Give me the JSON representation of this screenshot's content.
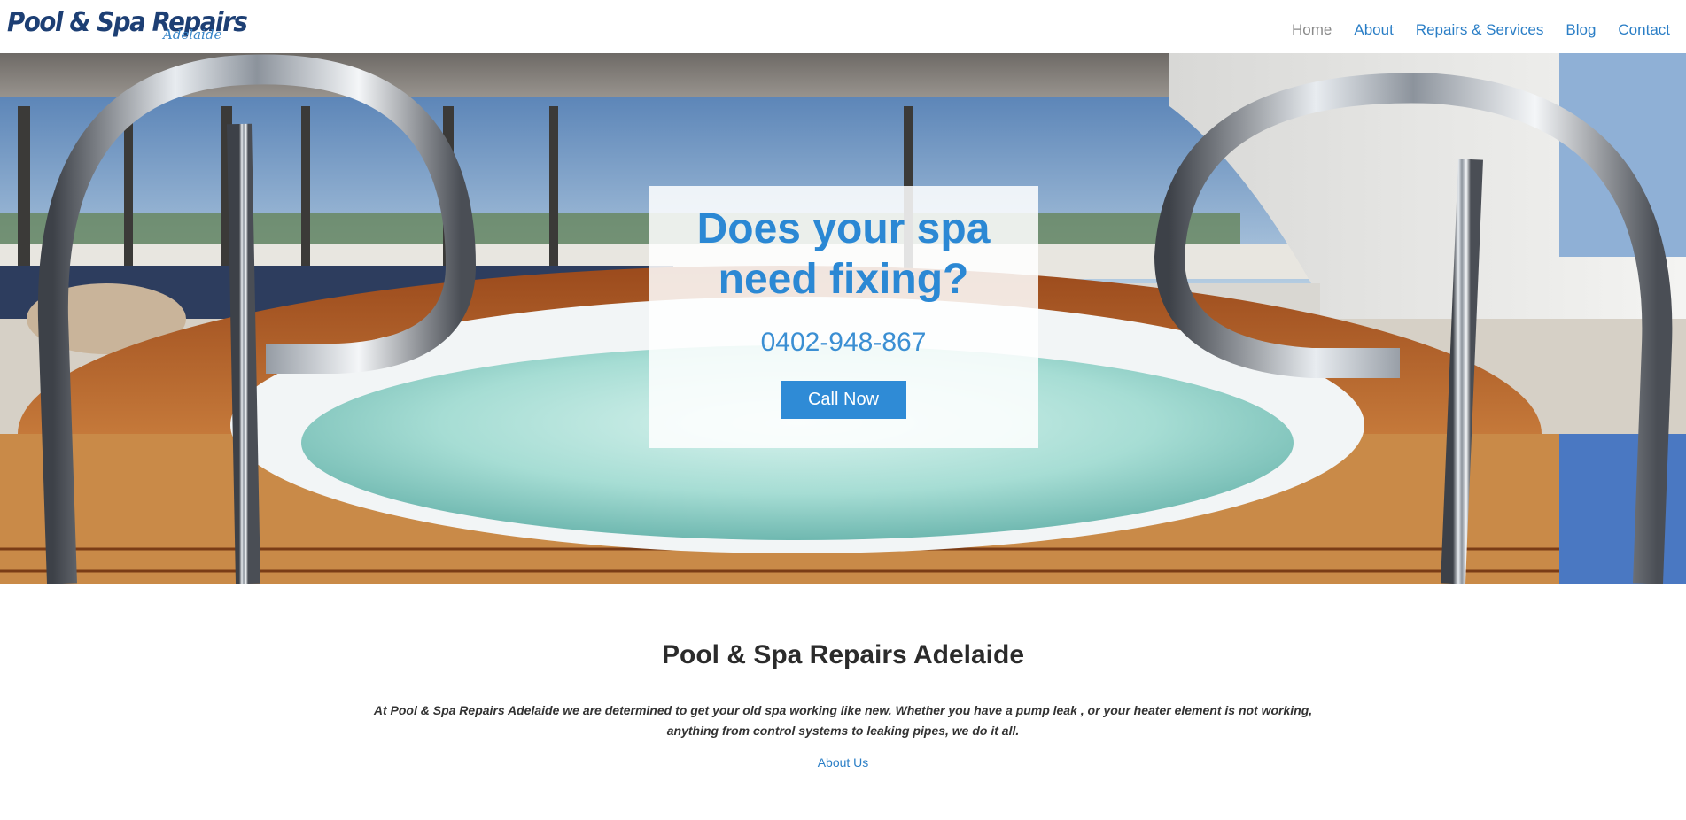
{
  "header": {
    "logo": {
      "main": "Pool & Spa Repairs",
      "sub": "Adelaide"
    },
    "nav": [
      {
        "label": "Home",
        "active": true
      },
      {
        "label": "About",
        "active": false
      },
      {
        "label": "Repairs & Services",
        "active": false
      },
      {
        "label": "Blog",
        "active": false
      },
      {
        "label": "Contact",
        "active": false
      }
    ]
  },
  "hero": {
    "title": "Does your spa need fixing?",
    "phone": "0402-948-867",
    "cta_label": "Call Now",
    "image_subject": "yacht-deck-spa-photo"
  },
  "content": {
    "title": "Pool & Spa Repairs Adelaide",
    "text": "At Pool & Spa Repairs Adelaide we are determined to get your old spa working like new. Whether you have a pump leak , or your heater element is not working, anything from control systems to leaking pipes, we do it all.",
    "link_label": "About Us"
  },
  "colors": {
    "accent": "#2b88d4",
    "button": "#2f8bd6",
    "logo_dark": "#1d3f74",
    "nav_active": "#8a8a8a"
  }
}
